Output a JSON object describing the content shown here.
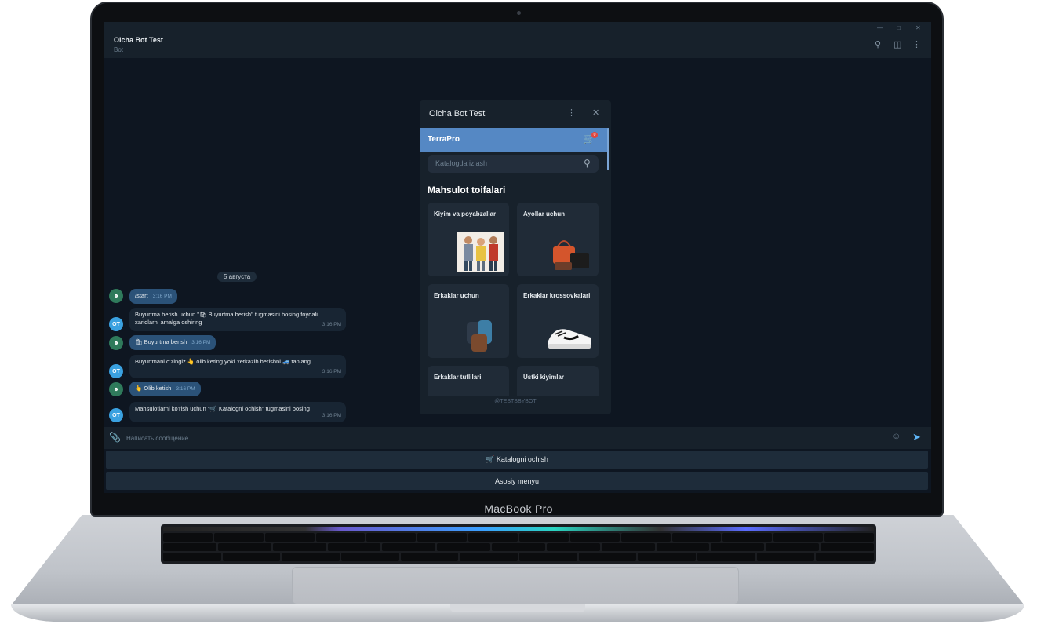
{
  "laptop": {
    "brand": "MacBook Pro"
  },
  "header": {
    "title": "Olcha Bot Test",
    "subtitle": "Bot"
  },
  "chat": {
    "date": "5 августа",
    "messages": [
      {
        "dir": "out",
        "text": "/start",
        "time": "3:16 PM"
      },
      {
        "dir": "in",
        "text": "Buyurtma berish uchun \"🛍 Buyurtma berish\" tugmasini bosing foydali xaridlarni amalga oshiring",
        "time": "3:16 PM"
      },
      {
        "dir": "out",
        "text": "🛍 Buyurtma berish",
        "time": "3:16 PM"
      },
      {
        "dir": "in",
        "text": "Buyurtmani o'zingiz 👆 olib keting yoki Yetkazib berishni 🚙 tanlang",
        "time": "3:16 PM"
      },
      {
        "dir": "out",
        "text": "👆 Olib ketish",
        "time": "3:16 PM"
      },
      {
        "dir": "in",
        "text": "Mahsulotlarni ko'rish uchun \"🛒 Katalogni ochish\" tugmasini bosing",
        "time": "3:16 PM"
      }
    ],
    "avatar_bot": "OT"
  },
  "composer": {
    "placeholder": "Написать сообщение..."
  },
  "keyboard_buttons": {
    "catalog": "🛒 Katalogni ochish",
    "menu": "Asosiy menyu"
  },
  "miniapp": {
    "title": "Olcha Bot Test",
    "store": "TerraPro",
    "cart_count": "0",
    "search_placeholder": "Katalogda izlash",
    "section_title": "Mahsulot toifalari",
    "categories": [
      {
        "label": "Kiyim va poyabzallar"
      },
      {
        "label": "Ayollar uchun"
      },
      {
        "label": "Erkaklar uchun"
      },
      {
        "label": "Erkaklar krossovkalari"
      },
      {
        "label": "Erkaklar tuflilari"
      },
      {
        "label": "Ustki kiyimlar"
      }
    ],
    "footer": "@TESTSBYBOT"
  },
  "colors": {
    "screen_bg": "#0e1621",
    "panel": "#17212b",
    "accent": "#5588c4",
    "bubble_out": "#2b5278"
  },
  "icons": [
    "search-icon",
    "columns-icon",
    "more-icon",
    "close-icon",
    "cart-icon",
    "paperclip-icon",
    "emoji-icon",
    "send-icon"
  ]
}
